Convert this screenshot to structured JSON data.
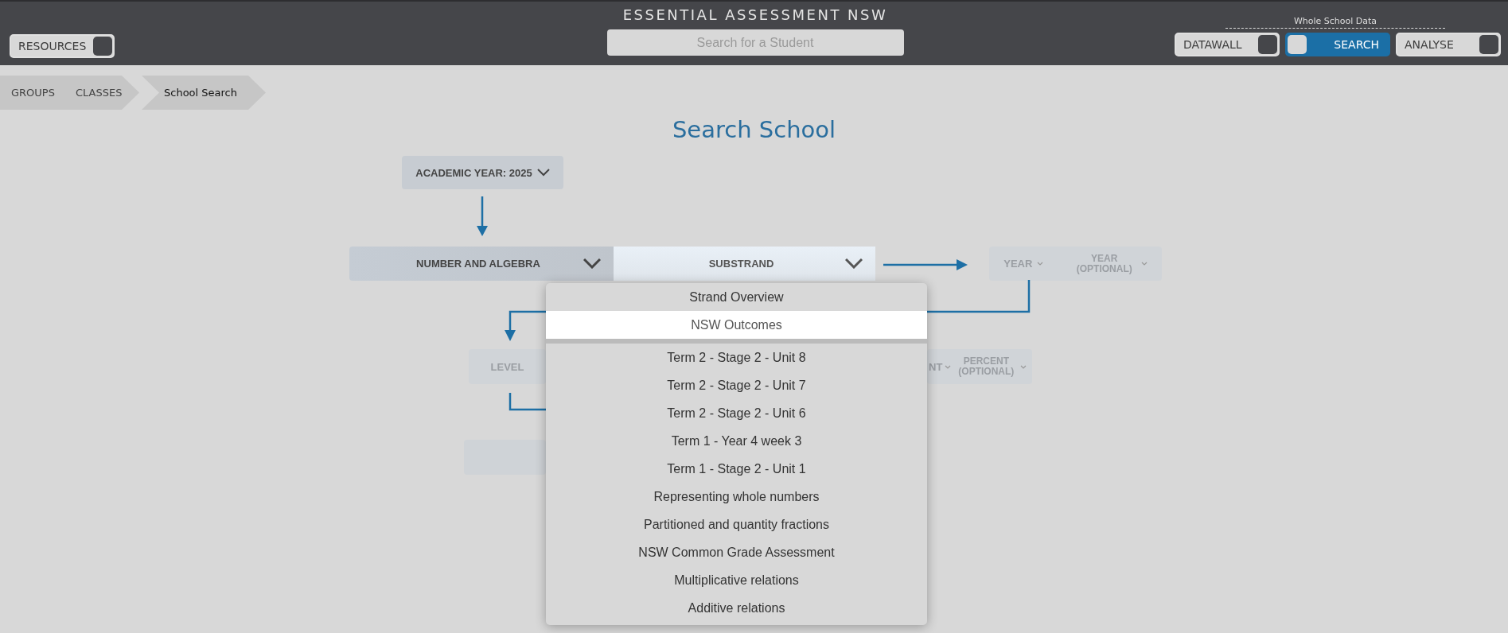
{
  "header": {
    "title": "ESSENTIAL ASSESSMENT NSW",
    "resources": {
      "label": "RESOURCES",
      "on": false
    },
    "search": {
      "placeholder": "Search for a Student"
    },
    "group_label": "Whole School Data",
    "modes": [
      {
        "label": "DATAWALL",
        "selected": false
      },
      {
        "label": "SEARCH",
        "selected": true
      },
      {
        "label": "ANALYSE",
        "selected": false
      }
    ]
  },
  "breadcrumbs": [
    {
      "label": "GROUPS",
      "current": false
    },
    {
      "label": "CLASSES",
      "current": false
    },
    {
      "label": "School Search",
      "current": true
    }
  ],
  "page_title": "Search School",
  "steps": {
    "academic_year": {
      "label": "ACADEMIC YEAR: 2025",
      "disabled": false
    },
    "strand": {
      "label": "NUMBER AND ALGEBRA",
      "disabled": false
    },
    "substrand": {
      "label": "SUBSTRAND",
      "open": true
    },
    "year": {
      "label": "YEAR",
      "disabled": true
    },
    "year_optional": {
      "label": "YEAR (OPTIONAL)",
      "disabled": true
    },
    "level": {
      "label": "LEVEL",
      "disabled": true
    },
    "cut_filter": {
      "label": "NT",
      "disabled": true
    },
    "percent_optional": {
      "label": "PERCENT (OPTIONAL)",
      "disabled": true
    }
  },
  "substrand_menu": {
    "top_items": [
      {
        "label": "Strand Overview",
        "selected": false
      },
      {
        "label": "NSW Outcomes",
        "selected": true
      }
    ],
    "items": [
      {
        "label": "Term 2 - Stage 2 - Unit 8",
        "selected": false
      },
      {
        "label": "Term 2 - Stage 2 - Unit 7",
        "selected": false
      },
      {
        "label": "Term 2 - Stage 2 - Unit 6",
        "selected": false
      },
      {
        "label": "Term 1 - Year 4 week 3",
        "selected": false
      },
      {
        "label": "Term 1 - Stage 2 - Unit 1",
        "selected": false
      },
      {
        "label": "Representing whole numbers",
        "selected": false
      },
      {
        "label": "Partitioned and quantity fractions",
        "selected": false
      },
      {
        "label": "NSW Common Grade Assessment",
        "selected": false
      },
      {
        "label": "Multiplicative relations",
        "selected": false
      },
      {
        "label": "Additive relations",
        "selected": false
      }
    ]
  }
}
